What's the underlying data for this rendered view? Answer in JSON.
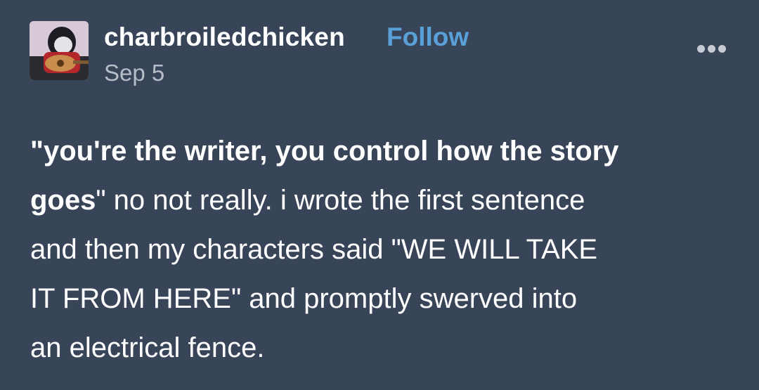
{
  "post": {
    "username": "charbroiledchicken",
    "follow_label": "Follow",
    "date": "Sep 5",
    "more_icon": "more-horizontal-icon",
    "body_lines": [
      [
        {
          "text": "\"you're the writer, you control how the story",
          "bold": true
        }
      ],
      [
        {
          "text": "goes",
          "bold": true
        },
        {
          "text": "\" no not really. i wrote the first sentence",
          "bold": false
        }
      ],
      [
        {
          "text": "and then my characters said \"WE WILL TAKE",
          "bold": false
        }
      ],
      [
        {
          "text": "IT FROM HERE\" and promptly swerved into",
          "bold": false
        }
      ],
      [
        {
          "text": "an electrical fence.",
          "bold": false
        }
      ]
    ]
  },
  "colors": {
    "background": "#384458",
    "text": "#ffffff",
    "follow": "#5aa0d8",
    "date": "#b7bdc8"
  }
}
